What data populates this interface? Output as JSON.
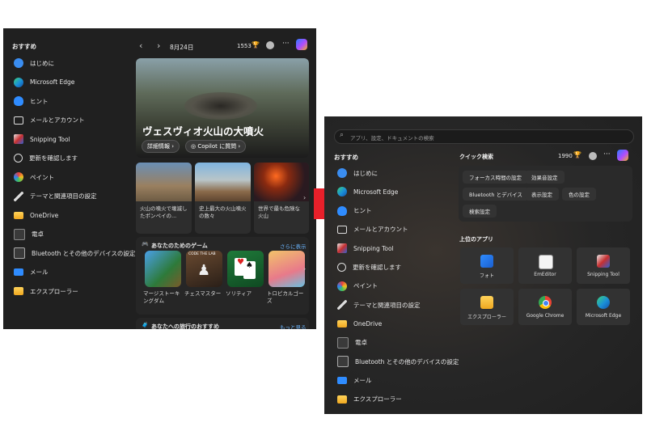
{
  "left": {
    "section_title": "おすすめ",
    "apps": [
      {
        "label": "はじめに",
        "icon": "get-started-icon"
      },
      {
        "label": "Microsoft Edge",
        "icon": "edge-icon"
      },
      {
        "label": "ヒント",
        "icon": "tips-icon"
      },
      {
        "label": "メールとアカウント",
        "icon": "mail-accounts-icon"
      },
      {
        "label": "Snipping Tool",
        "icon": "snipping-tool-icon"
      },
      {
        "label": "更新を確認します",
        "icon": "update-icon"
      },
      {
        "label": "ペイント",
        "icon": "paint-icon"
      },
      {
        "label": "テーマと関連項目の設定",
        "icon": "theme-pen-icon"
      },
      {
        "label": "OneDrive",
        "icon": "onedrive-icon"
      },
      {
        "label": "電卓",
        "icon": "calculator-icon"
      },
      {
        "label": "Bluetooth とその他のデバイスの設定",
        "icon": "bluetooth-devices-icon"
      },
      {
        "label": "メール",
        "icon": "mail-icon"
      },
      {
        "label": "エクスプローラー",
        "icon": "explorer-folder-icon"
      }
    ],
    "date": "8月24日",
    "points": "1553",
    "hero": {
      "title": "ヴェスヴィオ火山の大噴火",
      "details_button": "詳細情報",
      "copilot_button": "Copilot に質問"
    },
    "news": [
      {
        "caption": "火山の噴火で壊滅したポンペイの..."
      },
      {
        "caption": "史上最大の火山噴火の数々"
      },
      {
        "caption": "世界で最も危険な火山"
      }
    ],
    "games": {
      "title": "あなたのためのゲーム",
      "more": "さらに表示",
      "items": [
        {
          "label": "マージストーキングダム"
        },
        {
          "label": "チェスマスター",
          "badge": "CODE THE LAB"
        },
        {
          "label": "ソリティア"
        },
        {
          "label": "トロピカルゴーズ"
        }
      ]
    },
    "travel": {
      "title": "あなたへの旅行のおすすめ",
      "more": "もっと見る"
    }
  },
  "right": {
    "search_placeholder": "アプリ、設定、ドキュメントの検索",
    "section_title": "おすすめ",
    "apps": [
      {
        "label": "はじめに",
        "icon": "get-started-icon"
      },
      {
        "label": "Microsoft Edge",
        "icon": "edge-icon"
      },
      {
        "label": "ヒント",
        "icon": "tips-icon"
      },
      {
        "label": "メールとアカウント",
        "icon": "mail-accounts-icon"
      },
      {
        "label": "Snipping Tool",
        "icon": "snipping-tool-icon"
      },
      {
        "label": "更新を確認します",
        "icon": "update-icon"
      },
      {
        "label": "ペイント",
        "icon": "paint-icon"
      },
      {
        "label": "テーマと関連項目の設定",
        "icon": "theme-pen-icon"
      },
      {
        "label": "OneDrive",
        "icon": "onedrive-icon"
      },
      {
        "label": "電卓",
        "icon": "calculator-icon"
      },
      {
        "label": "Bluetooth とその他のデバイスの設定",
        "icon": "bluetooth-devices-icon"
      },
      {
        "label": "メール",
        "icon": "mail-icon"
      },
      {
        "label": "エクスプローラー",
        "icon": "explorer-folder-icon"
      }
    ],
    "quick_search": {
      "title": "クイック検索",
      "chips": [
        "フォーカス時間の設定",
        "効果音設定",
        "Bluetooth とデバイス",
        "表示設定",
        "色の設定",
        "検索設定"
      ]
    },
    "points": "1990",
    "top_apps": {
      "title": "上位のアプリ",
      "items": [
        {
          "label": "フォト",
          "icon": "photos-icon"
        },
        {
          "label": "EmEditor",
          "icon": "emeditor-icon"
        },
        {
          "label": "Snipping Tool",
          "icon": "snipping-tool-icon"
        },
        {
          "label": "エクスプローラー",
          "icon": "explorer-folder-icon"
        },
        {
          "label": "Google Chrome",
          "icon": "chrome-icon"
        },
        {
          "label": "Microsoft Edge",
          "icon": "edge-icon"
        }
      ]
    }
  },
  "colors": {
    "arrow": "#e8202a",
    "panel_bg": "#202020",
    "copilot_a": "#2a7bff",
    "copilot_b": "#f0b020"
  }
}
